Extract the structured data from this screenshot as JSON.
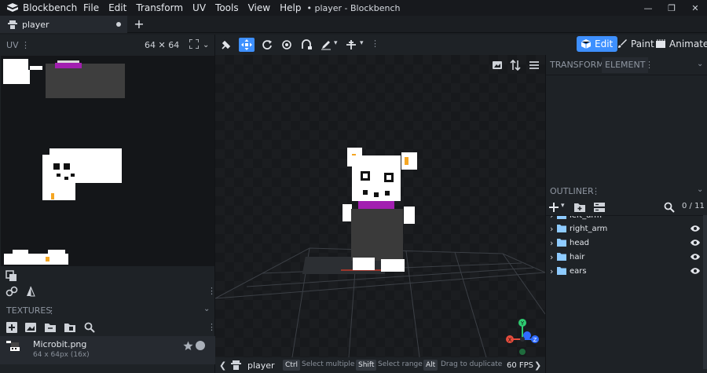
{
  "app": {
    "name": "Blockbench",
    "window_title": "• player - Blockbench",
    "menu": [
      "File",
      "Edit",
      "Transform",
      "UV",
      "Tools",
      "View",
      "Help"
    ],
    "window_controls": [
      "—",
      "❐",
      "✕"
    ]
  },
  "tabs": [
    {
      "label": "player",
      "unsaved": true
    }
  ],
  "new_tab_label": "+",
  "uv_panel": {
    "title": "UV",
    "menu_dots": "⋮",
    "size": "64 ✕ 64",
    "chevron": "⌄"
  },
  "textures_panel": {
    "title": "TEXTURES",
    "menu_dots": "⋮",
    "chevron": "⌄",
    "items": [
      {
        "name": "Microbit.png",
        "info": "64 x 64px (16x)"
      }
    ]
  },
  "modes": {
    "edit": "Edit",
    "paint": "Paint",
    "animate": "Animate",
    "active": "Edit"
  },
  "right_panel": {
    "tabs": [
      "TRANSFORM",
      "ELEMENT"
    ],
    "active_tab": "ELEMENT",
    "menu_dots": "⋮",
    "chevron": "⌄"
  },
  "outliner": {
    "title": "OUTLINER",
    "menu_dots": "⋮",
    "chevron": "⌄",
    "count": "0 / 11",
    "items": [
      {
        "label": "left_arm"
      },
      {
        "label": "right_arm"
      },
      {
        "label": "head"
      },
      {
        "label": "hair"
      },
      {
        "label": "ears"
      }
    ]
  },
  "statusbar": {
    "prev": "❮",
    "model": "player",
    "hints": [
      {
        "key": "Ctrl",
        "text": "Select multiple"
      },
      {
        "key": "Shift",
        "text": "Select range"
      },
      {
        "key": "Alt",
        "text": "Drag to duplicate"
      }
    ],
    "fps": "60 FPS",
    "next": "❯"
  },
  "gizmo_axes": {
    "y": "Y",
    "x": "X",
    "z": "Z"
  },
  "colors": {
    "accent": "#3e90ff",
    "hat": "#4a4a4a",
    "body": "#3a3a3a",
    "face": "#ffffff",
    "ribbon": "#a21fb0",
    "ear_inner": "#f5a623",
    "axis_x": "#e74c3c",
    "axis_y": "#2ecc71",
    "axis_z": "#3e7bff"
  }
}
